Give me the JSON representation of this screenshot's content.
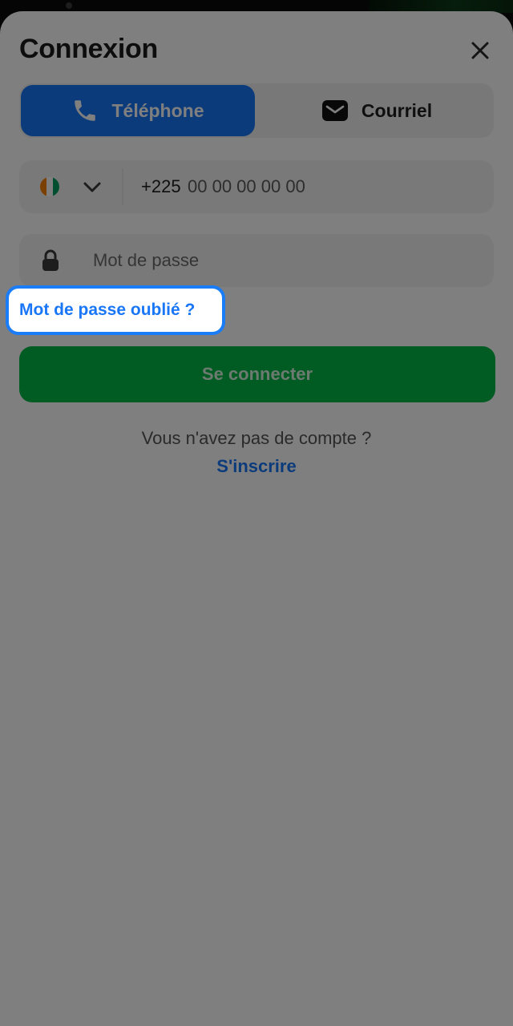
{
  "header": {
    "title": "Connexion",
    "close_icon": "close-icon"
  },
  "login_method_tabs": [
    {
      "label": "Téléphone",
      "icon": "phone-icon",
      "selected": true
    },
    {
      "label": "Courriel",
      "icon": "mail-icon",
      "selected": false
    }
  ],
  "phone_field": {
    "country_flag": "cote-divoire-flag-icon",
    "dial_code": "+225",
    "placeholder": "00 00 00 00 00"
  },
  "password_field": {
    "placeholder": "Mot de passe"
  },
  "forgot_password_label": "Mot de passe oublié ?",
  "login_button_label": "Se connecter",
  "footer": {
    "no_account_text": "Vous n'avez pas de compte ?",
    "signup_label": "S'inscrire"
  },
  "colors": {
    "accent_blue": "#1976f6",
    "login_green": "#00b846",
    "flag_orange": "#f77f00",
    "flag_white": "#ffffff",
    "flag_green": "#009e60"
  }
}
